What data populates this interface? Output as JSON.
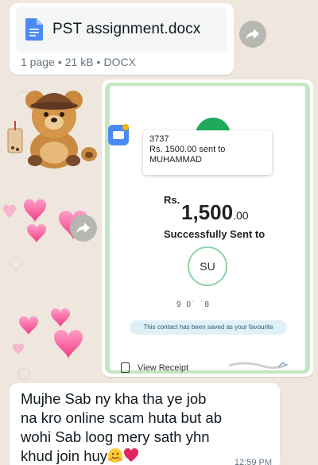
{
  "document": {
    "file_name": "PST assignment.docx",
    "pages": "1 page",
    "size": "21 kB",
    "type": "DOCX",
    "separator": "•",
    "icon": "document-icon"
  },
  "receipt": {
    "notification": {
      "sender": "3737",
      "line1": "Rs. 1500.00 sent to",
      "line2": "MUHAMMAD"
    },
    "currency": "Rs.",
    "amount": "1,500",
    "amount_decimal": ".00",
    "status": "Successfully Sent to",
    "recipient_initials": "SU",
    "recipient_partial": "9 0˙    ˙8",
    "favourite_note": "This contact has been saved as your favourite",
    "view_receipt": "View Receipt",
    "colors": {
      "accent_green": "#1faa59",
      "pill_bg": "#dff1f7"
    }
  },
  "message": {
    "text": "Mujhe Sab ny kha tha ye job\nna kro online scam huta but ab\nwohi Sab loog mery sath yhn\nkhud join huy",
    "emoji": "hugging-face-and-heart",
    "time": "12:59 PM"
  },
  "stickers": [
    "teddy-bear-sticker",
    "pink-hearts-sticker",
    "pink-hearts-sticker"
  ],
  "colors": {
    "chat_bg": "#efe7dd",
    "bubble_bg": "#ffffff",
    "meta_text": "#667781"
  }
}
